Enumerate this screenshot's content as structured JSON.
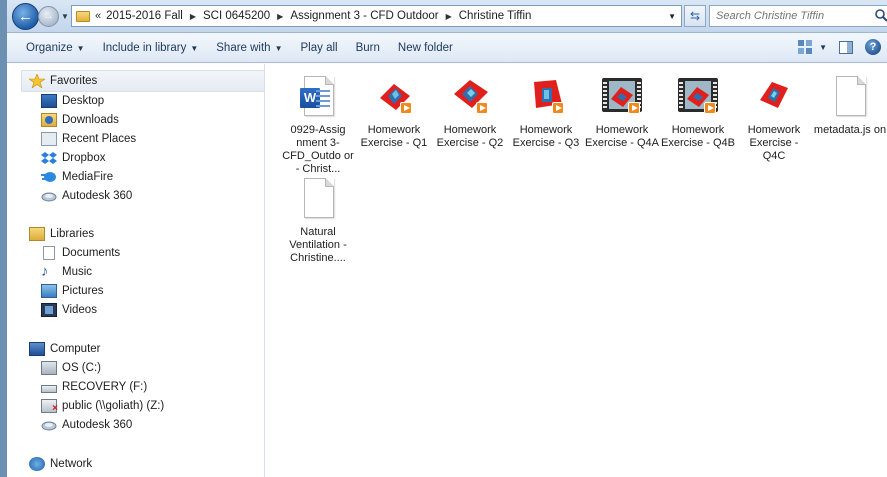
{
  "address": {
    "overflow": "«",
    "breadcrumbs": [
      "2015-2016 Fall",
      "SCI 0645200",
      "Assignment 3 - CFD Outdoor",
      "Christine Tiffin"
    ]
  },
  "search": {
    "placeholder": "Search Christine Tiffin"
  },
  "toolbar": {
    "organize": "Organize",
    "include": "Include in library",
    "share": "Share with",
    "play": "Play all",
    "burn": "Burn",
    "new_folder": "New folder"
  },
  "nav": {
    "favorites": "Favorites",
    "fav_items": [
      "Desktop",
      "Downloads",
      "Recent Places",
      "Dropbox",
      "MediaFire",
      "Autodesk 360"
    ],
    "libraries": "Libraries",
    "lib_items": [
      "Documents",
      "Music",
      "Pictures",
      "Videos"
    ],
    "computer": "Computer",
    "comp_items": [
      "OS (C:)",
      "RECOVERY (F:)",
      "public (\\\\goliath) (Z:)",
      "Autodesk 360"
    ],
    "network": "Network"
  },
  "files": [
    {
      "name": "0929-Assig nment 3- CFD_Outdo or - Christ...",
      "type": "word"
    },
    {
      "name": "Homework Exercise - Q1",
      "type": "image-video"
    },
    {
      "name": "Homework Exercise - Q2",
      "type": "image-video"
    },
    {
      "name": "Homework Exercise - Q3",
      "type": "image-video"
    },
    {
      "name": "Homework Exercise - Q4A",
      "type": "film"
    },
    {
      "name": "Homework Exercise - Q4B",
      "type": "film"
    },
    {
      "name": "Homework Exercise - Q4C",
      "type": "image"
    },
    {
      "name": "metadata.js on",
      "type": "blank"
    },
    {
      "name": "Natural Ventilation - Christine....",
      "type": "blank"
    }
  ],
  "colors": {
    "accent": "#1f5ea8",
    "cfd_red": "#e0201c",
    "cfd_blue": "#2d6fb0"
  }
}
